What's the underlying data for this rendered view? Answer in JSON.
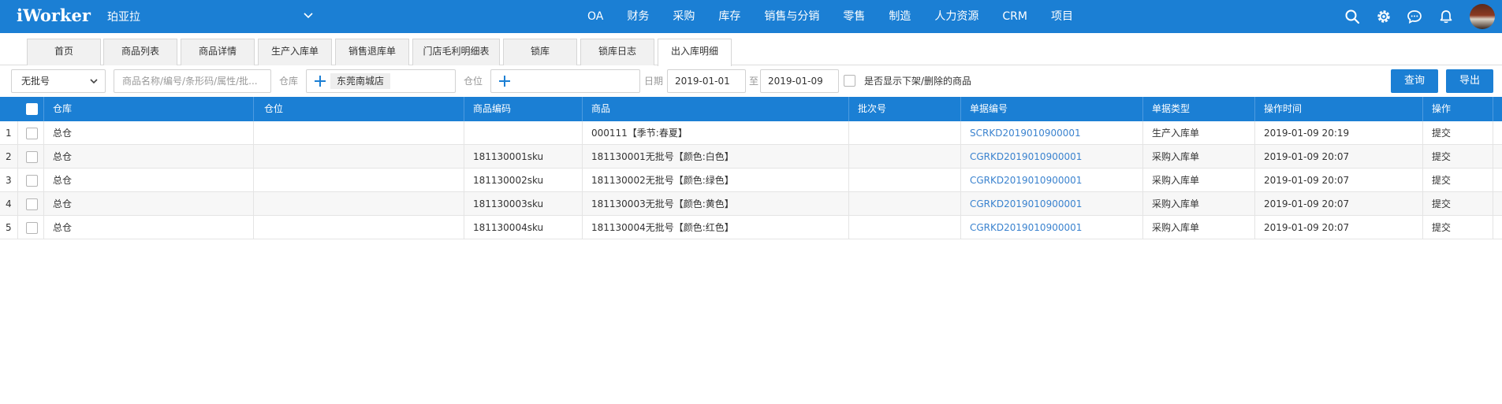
{
  "header": {
    "logo": "iWorker",
    "company": "珀亚拉",
    "nav": [
      "OA",
      "财务",
      "采购",
      "库存",
      "销售与分销",
      "零售",
      "制造",
      "人力资源",
      "CRM",
      "项目"
    ]
  },
  "tabs": [
    {
      "label": "首页",
      "active": false
    },
    {
      "label": "商品列表",
      "active": false
    },
    {
      "label": "商品详情",
      "active": false
    },
    {
      "label": "生产入库单",
      "active": false
    },
    {
      "label": "销售退库单",
      "active": false
    },
    {
      "label": "门店毛利明细表",
      "active": false
    },
    {
      "label": "锁库",
      "active": false
    },
    {
      "label": "锁库日志",
      "active": false
    },
    {
      "label": "出入库明细",
      "active": true
    }
  ],
  "filters": {
    "batch_select": "无批号",
    "product_search_placeholder": "商品名称/编号/条形码/属性/批...",
    "warehouse_label": "仓库",
    "warehouse_chip": "东莞南城店",
    "location_label": "仓位",
    "date_label": "日期",
    "date_from": "2019-01-01",
    "date_to_label": "至",
    "date_to": "2019-01-09",
    "show_removed_label": "是否显示下架/删除的商品",
    "query_button": "查询",
    "export_button": "导出"
  },
  "table": {
    "columns": [
      "仓库",
      "仓位",
      "商品编码",
      "商品",
      "批次号",
      "单据编号",
      "单据类型",
      "操作时间",
      "操作"
    ],
    "rows": [
      {
        "index": "1",
        "warehouse": "总仓",
        "location": "",
        "code": "",
        "product": "000111【季节:春夏】",
        "batch": "",
        "doc_no": "SCRKD2019010900001",
        "doc_type": "生产入库单",
        "time": "2019-01-09 20:19",
        "op": "提交"
      },
      {
        "index": "2",
        "warehouse": "总仓",
        "location": "",
        "code": "181130001sku",
        "product": "181130001无批号【颜色:白色】",
        "batch": "",
        "doc_no": "CGRKD2019010900001",
        "doc_type": "采购入库单",
        "time": "2019-01-09 20:07",
        "op": "提交"
      },
      {
        "index": "3",
        "warehouse": "总仓",
        "location": "",
        "code": "181130002sku",
        "product": "181130002无批号【颜色:绿色】",
        "batch": "",
        "doc_no": "CGRKD2019010900001",
        "doc_type": "采购入库单",
        "time": "2019-01-09 20:07",
        "op": "提交"
      },
      {
        "index": "4",
        "warehouse": "总仓",
        "location": "",
        "code": "181130003sku",
        "product": "181130003无批号【颜色:黄色】",
        "batch": "",
        "doc_no": "CGRKD2019010900001",
        "doc_type": "采购入库单",
        "time": "2019-01-09 20:07",
        "op": "提交"
      },
      {
        "index": "5",
        "warehouse": "总仓",
        "location": "",
        "code": "181130004sku",
        "product": "181130004无批号【颜色:红色】",
        "batch": "",
        "doc_no": "CGRKD2019010900001",
        "doc_type": "采购入库单",
        "time": "2019-01-09 20:07",
        "op": "提交"
      }
    ]
  },
  "colors": {
    "primary": "#1b7fd4",
    "link": "#3b83cf",
    "row_alt": "#f7f7f7"
  },
  "icons": [
    "search-icon",
    "gear-icon",
    "chat-icon",
    "bell-icon",
    "chevron-down-icon",
    "plus-icon"
  ]
}
